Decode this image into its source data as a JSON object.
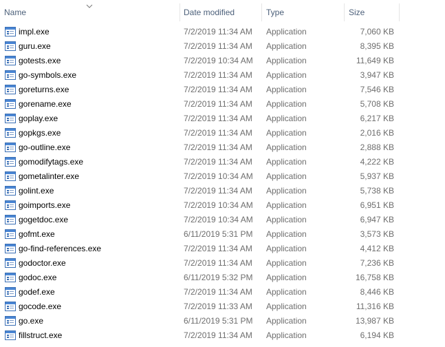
{
  "columns": {
    "name": "Name",
    "date_modified": "Date modified",
    "type": "Type",
    "size": "Size"
  },
  "sort": {
    "column": "name",
    "icon": "chevron-down-icon"
  },
  "file_icon": "application-exe-icon",
  "colors": {
    "header_text": "#4c607a",
    "detail_text": "#6d6d6d",
    "icon_border": "#3a6fb5",
    "icon_bar": "#4a86d4"
  },
  "files": [
    {
      "name": "impl.exe",
      "date": "7/2/2019 11:34 AM",
      "type": "Application",
      "size": "7,060 KB"
    },
    {
      "name": "guru.exe",
      "date": "7/2/2019 11:34 AM",
      "type": "Application",
      "size": "8,395 KB"
    },
    {
      "name": "gotests.exe",
      "date": "7/2/2019 10:34 AM",
      "type": "Application",
      "size": "11,649 KB"
    },
    {
      "name": "go-symbols.exe",
      "date": "7/2/2019 11:34 AM",
      "type": "Application",
      "size": "3,947 KB"
    },
    {
      "name": "goreturns.exe",
      "date": "7/2/2019 11:34 AM",
      "type": "Application",
      "size": "7,546 KB"
    },
    {
      "name": "gorename.exe",
      "date": "7/2/2019 11:34 AM",
      "type": "Application",
      "size": "5,708 KB"
    },
    {
      "name": "goplay.exe",
      "date": "7/2/2019 11:34 AM",
      "type": "Application",
      "size": "6,217 KB"
    },
    {
      "name": "gopkgs.exe",
      "date": "7/2/2019 11:34 AM",
      "type": "Application",
      "size": "2,016 KB"
    },
    {
      "name": "go-outline.exe",
      "date": "7/2/2019 11:34 AM",
      "type": "Application",
      "size": "2,888 KB"
    },
    {
      "name": "gomodifytags.exe",
      "date": "7/2/2019 11:34 AM",
      "type": "Application",
      "size": "4,222 KB"
    },
    {
      "name": "gometalinter.exe",
      "date": "7/2/2019 10:34 AM",
      "type": "Application",
      "size": "5,937 KB"
    },
    {
      "name": "golint.exe",
      "date": "7/2/2019 11:34 AM",
      "type": "Application",
      "size": "5,738 KB"
    },
    {
      "name": "goimports.exe",
      "date": "7/2/2019 10:34 AM",
      "type": "Application",
      "size": "6,951 KB"
    },
    {
      "name": "gogetdoc.exe",
      "date": "7/2/2019 10:34 AM",
      "type": "Application",
      "size": "6,947 KB"
    },
    {
      "name": "gofmt.exe",
      "date": "6/11/2019 5:31 PM",
      "type": "Application",
      "size": "3,573 KB"
    },
    {
      "name": "go-find-references.exe",
      "date": "7/2/2019 11:34 AM",
      "type": "Application",
      "size": "4,412 KB"
    },
    {
      "name": "godoctor.exe",
      "date": "7/2/2019 11:34 AM",
      "type": "Application",
      "size": "7,236 KB"
    },
    {
      "name": "godoc.exe",
      "date": "6/11/2019 5:32 PM",
      "type": "Application",
      "size": "16,758 KB"
    },
    {
      "name": "godef.exe",
      "date": "7/2/2019 11:34 AM",
      "type": "Application",
      "size": "8,446 KB"
    },
    {
      "name": "gocode.exe",
      "date": "7/2/2019 11:33 AM",
      "type": "Application",
      "size": "11,316 KB"
    },
    {
      "name": "go.exe",
      "date": "6/11/2019 5:31 PM",
      "type": "Application",
      "size": "13,987 KB"
    },
    {
      "name": "fillstruct.exe",
      "date": "7/2/2019 11:34 AM",
      "type": "Application",
      "size": "6,194 KB"
    }
  ]
}
